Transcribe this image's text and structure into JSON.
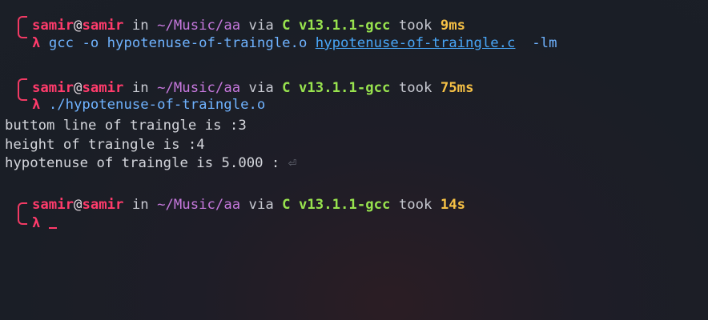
{
  "prompts": [
    {
      "user": "samir",
      "at": "@",
      "host": "samir",
      "in_word": "in",
      "path": "~/Music/aa",
      "via_word": "via",
      "lang_icon": "C",
      "version": "v13.1.1-gcc",
      "took_word": "took",
      "duration": "9ms",
      "symbol": "λ",
      "command": {
        "program": "gcc",
        "args_before": "-o hypotenuse-of-traingle.o",
        "source_file": "hypotenuse-of-traingle.c",
        "args_after": "-lm"
      }
    },
    {
      "user": "samir",
      "at": "@",
      "host": "samir",
      "in_word": "in",
      "path": "~/Music/aa",
      "via_word": "via",
      "lang_icon": "C",
      "version": "v13.1.1-gcc",
      "took_word": "took",
      "duration": "75ms",
      "symbol": "λ",
      "command_text": "./hypotenuse-of-traingle.o"
    },
    {
      "user": "samir",
      "at": "@",
      "host": "samir",
      "in_word": "in",
      "path": "~/Music/aa",
      "via_word": "via",
      "lang_icon": "C",
      "version": "v13.1.1-gcc",
      "took_word": "took",
      "duration": "14s",
      "symbol": "λ"
    }
  ],
  "output_lines": [
    "buttom line of traingle is :3",
    "height of traingle is :4",
    "hypotenuse of traingle is 5.000 : "
  ],
  "return_symbol": "⏎",
  "colors": {
    "accent_pink": "#ff3b6b",
    "path_purple": "#c678dd",
    "version_green": "#98e34e",
    "duration_yellow": "#f5c045",
    "command_blue": "#6fb3ff"
  }
}
